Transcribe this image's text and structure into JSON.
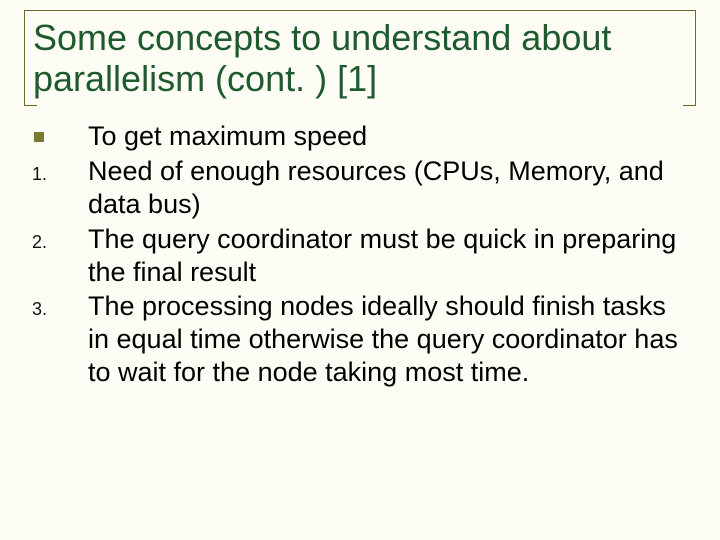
{
  "slide": {
    "title": "Some concepts to understand about parallelism (cont. ) [1]",
    "items": [
      {
        "marker_type": "square",
        "marker": "",
        "text": "To get maximum speed"
      },
      {
        "marker_type": "number",
        "marker": "1.",
        "text": "Need of enough resources (CPUs, Memory, and data bus)"
      },
      {
        "marker_type": "number",
        "marker": "2.",
        "text": "The query coordinator must be quick in preparing the final result"
      },
      {
        "marker_type": "number",
        "marker": "3.",
        "text": "The processing nodes ideally should finish tasks in equal time otherwise the query coordinator has to wait for the node taking most time."
      }
    ]
  }
}
